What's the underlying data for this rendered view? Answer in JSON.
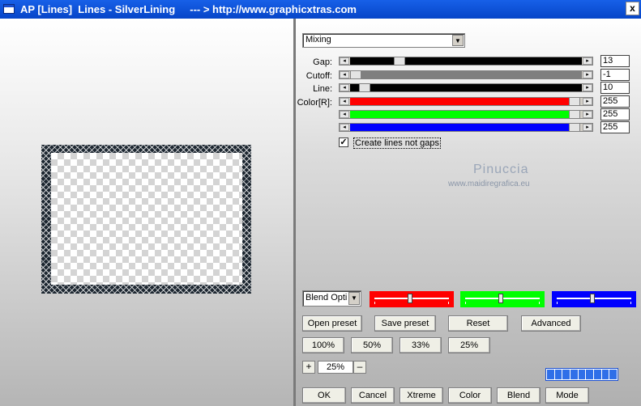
{
  "window": {
    "title": "AP [Lines]  Lines - SilverLining     --- > http://www.graphicxtras.com",
    "close": "x"
  },
  "mode_select": {
    "value": "Mixing"
  },
  "sliders": [
    {
      "label": "Gap:",
      "value": "13",
      "level": 0.2,
      "fill": "#000000"
    },
    {
      "label": "Cutoff:",
      "value": "-1",
      "level": 0.0,
      "fill": "#7f7f7f"
    },
    {
      "label": "Line:",
      "value": "10",
      "level": 0.04,
      "fill": "#000000"
    },
    {
      "label": "Color[R]:",
      "value": "255",
      "level": 1.0,
      "fill": "#ff0000"
    },
    {
      "label": "",
      "value": "255",
      "level": 1.0,
      "fill": "#00ff00"
    },
    {
      "label": "",
      "value": "255",
      "level": 1.0,
      "fill": "#0000ff"
    }
  ],
  "checkbox": {
    "label": "Create lines not gaps",
    "checked": "✓"
  },
  "watermark": {
    "name": "Pinuccia",
    "url": "www.maidiregrafica.eu"
  },
  "blend_select": {
    "value": "Blend Opti"
  },
  "color_controls": [
    {
      "color": "#ff0000",
      "level": 0.48
    },
    {
      "color": "#00ff00",
      "level": 0.48
    },
    {
      "color": "#0000ff",
      "level": 0.48
    }
  ],
  "buttons": {
    "open_preset": "Open preset",
    "save_preset": "Save preset",
    "reset": "Reset",
    "advanced": "Advanced",
    "zoom_100": "100%",
    "zoom_50": "50%",
    "zoom_33": "33%",
    "zoom_25": "25%",
    "ok": "OK",
    "cancel": "Cancel",
    "xtreme": "Xtreme",
    "color": "Color",
    "blend": "Blend",
    "mode": "Mode"
  },
  "zoom": {
    "plus": "+",
    "value": "25%",
    "minus": "–"
  }
}
